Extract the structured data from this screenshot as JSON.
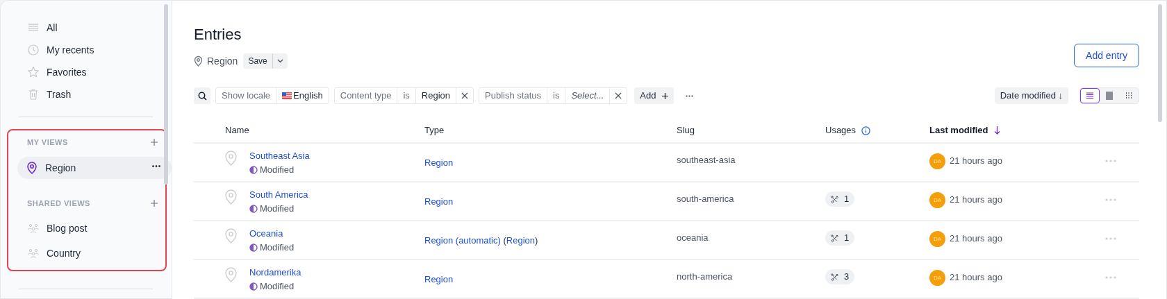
{
  "sidebar": {
    "items": [
      {
        "label": "All",
        "selected": false
      },
      {
        "label": "My recents",
        "selected": false
      },
      {
        "label": "Favorites",
        "selected": false
      },
      {
        "label": "Trash",
        "selected": false
      }
    ],
    "sections": [
      {
        "title": "MY VIEWS",
        "items": [
          {
            "label": "Region",
            "selected": true
          }
        ]
      },
      {
        "title": "SHARED VIEWS",
        "items": [
          {
            "label": "Blog post",
            "selected": false
          },
          {
            "label": "Country",
            "selected": false
          }
        ]
      }
    ]
  },
  "page": {
    "title": "Entries",
    "view_name": "Region",
    "save_label": "Save",
    "add_entry": "Add entry"
  },
  "filters": [
    {
      "parts": [
        {
          "text": "Show locale",
          "kind": "label"
        },
        {
          "text": "English",
          "kind": "flag"
        }
      ],
      "removable": false
    },
    {
      "parts": [
        {
          "text": "Content type",
          "kind": "label"
        },
        {
          "text": "is",
          "kind": "label"
        },
        {
          "text": "Region",
          "kind": "value"
        }
      ],
      "removable": true
    },
    {
      "parts": [
        {
          "text": "Publish status",
          "kind": "label"
        },
        {
          "text": "is",
          "kind": "label"
        },
        {
          "text": "Select...",
          "kind": "placeholder"
        }
      ],
      "removable": true
    }
  ],
  "add_filter": "Add",
  "sort": "Date modified ↓",
  "view_modes": [
    {
      "selected": true
    },
    {
      "selected": false
    },
    {
      "selected": false
    }
  ],
  "table": {
    "columns": [
      {
        "label": "Name",
        "sorted": false
      },
      {
        "label": "Type",
        "sorted": false
      },
      {
        "label": "Slug",
        "sorted": false
      },
      {
        "label": "Usages",
        "sorted": false,
        "info": true
      },
      {
        "label": "Last modified",
        "sorted": true
      }
    ],
    "rows": [
      {
        "name": "Southeast Asia",
        "status": "Modified",
        "type": [
          {
            "text": "Region",
            "kind": "link"
          }
        ],
        "slug": "southeast-asia",
        "avatar": "DA",
        "modified": "21 hours ago"
      },
      {
        "name": "South America",
        "status": "Modified",
        "type": [
          {
            "text": "Region",
            "kind": "link"
          }
        ],
        "slug": "south-america",
        "usages": "1",
        "avatar": "DA",
        "modified": "21 hours ago"
      },
      {
        "name": "Oceania",
        "status": "Modified",
        "type": [
          {
            "text": "Region (automatic)",
            "kind": "link"
          },
          {
            "text": " (",
            "kind": "plain"
          },
          {
            "text": "Region",
            "kind": "link"
          },
          {
            "text": ")",
            "kind": "plain"
          }
        ],
        "slug": "oceania",
        "usages": "1",
        "avatar": "DA",
        "modified": "21 hours ago"
      },
      {
        "name": "Nordamerika",
        "status": "Modified",
        "type": [
          {
            "text": "Region",
            "kind": "link"
          }
        ],
        "slug": "north-america",
        "usages": "3",
        "avatar": "DA",
        "modified": "21 hours ago"
      }
    ]
  }
}
